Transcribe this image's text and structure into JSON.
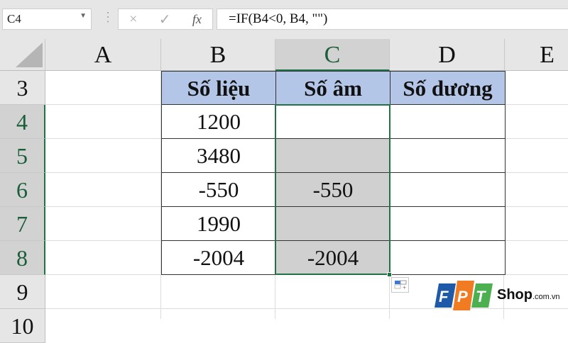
{
  "name_box": "C4",
  "formula_bar": {
    "cancel_icon": "×",
    "enter_icon": "✓",
    "fx_label": "fx",
    "formula": "=IF(B4<0, B4, \"\")"
  },
  "columns": [
    "A",
    "B",
    "C",
    "D",
    "E"
  ],
  "rows": [
    "3",
    "4",
    "5",
    "6",
    "7",
    "8",
    "9",
    "10"
  ],
  "table": {
    "headers": [
      "Số liệu",
      "Số âm",
      "Số dương"
    ],
    "data": [
      {
        "b": "1200",
        "c": "",
        "d": ""
      },
      {
        "b": "3480",
        "c": "",
        "d": ""
      },
      {
        "b": "-550",
        "c": "-550",
        "d": ""
      },
      {
        "b": "1990",
        "c": "",
        "d": ""
      },
      {
        "b": "-2004",
        "c": "-2004",
        "d": ""
      }
    ]
  },
  "watermark": {
    "logo": "FPT",
    "text": "Shop",
    "suffix": ".com.vn"
  },
  "colors": {
    "header_fill": "#b4c6e7",
    "selection": "#217346",
    "fpt_blue": "#1e5aa8",
    "fpt_orange": "#f07b22",
    "fpt_green": "#4caf50"
  }
}
